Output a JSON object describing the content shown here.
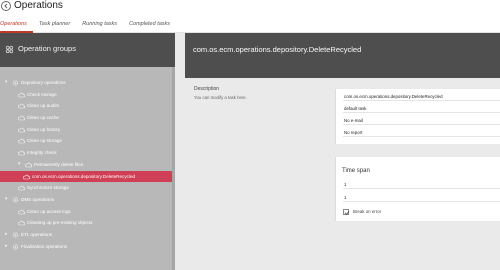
{
  "app": {
    "title": "Operations"
  },
  "tabs": [
    {
      "label": "Operations",
      "active": true
    },
    {
      "label": "Task planner",
      "active": false
    },
    {
      "label": "Running tasks",
      "active": false
    },
    {
      "label": "Completed tasks",
      "active": false
    }
  ],
  "sidebar": {
    "title": "Operation groups",
    "items": [
      {
        "label": "Depository operations",
        "level": 0,
        "type": "group",
        "expanded": true
      },
      {
        "label": "Check storage",
        "level": 1,
        "type": "task"
      },
      {
        "label": "Clean up audits",
        "level": 1,
        "type": "task"
      },
      {
        "label": "Clean up cache",
        "level": 1,
        "type": "task"
      },
      {
        "label": "Clean up history",
        "level": 1,
        "type": "task"
      },
      {
        "label": "Clean up storage",
        "level": 1,
        "type": "task"
      },
      {
        "label": "Integrity check",
        "level": 1,
        "type": "task"
      },
      {
        "label": "Permanently delete files",
        "level": 1,
        "type": "folder",
        "expanded": true
      },
      {
        "label": "com.os.ecm.operations.depository.DeleteRecycled",
        "level": 2,
        "type": "task",
        "selected": true
      },
      {
        "label": "Synchronize storage",
        "level": 1,
        "type": "task"
      },
      {
        "label": "DMS operations",
        "level": 0,
        "type": "group",
        "expanded": true
      },
      {
        "label": "Clean up access logs",
        "level": 1,
        "type": "task"
      },
      {
        "label": "Cleaning up pre-existing objects",
        "level": 1,
        "type": "task"
      },
      {
        "label": "ETL operations",
        "level": 0,
        "type": "group",
        "expanded": false
      },
      {
        "label": "Finalization operations",
        "level": 0,
        "type": "group",
        "expanded": false
      }
    ]
  },
  "main": {
    "title": "com.os.ecm.operations.depository.DeleteRecycled",
    "description": {
      "label": "Description",
      "hint": "You can modify a task here."
    },
    "fields": [
      "com.os.ecm.operations.depository.DeleteRecycled",
      "default task",
      "No e-mail",
      "No report"
    ],
    "time_span": {
      "label": "Time span",
      "values": [
        "1",
        "1"
      ]
    },
    "break_on_error": {
      "label": "Break on error",
      "checked": true
    }
  },
  "colors": {
    "accent": "#c0392b",
    "selected_row": "#cf3f55",
    "panel_header": "#4e4e4e",
    "sidebar_bg": "#b8b8b8"
  }
}
